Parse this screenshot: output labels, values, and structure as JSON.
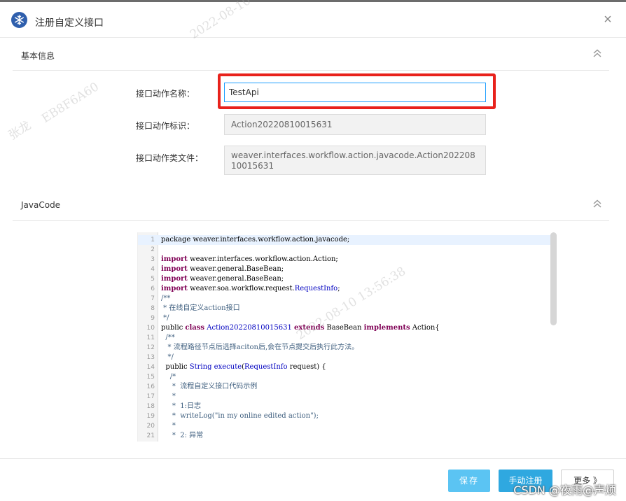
{
  "dialog": {
    "title": "注册自定义接口",
    "close_label": "×"
  },
  "sections": {
    "basic_info": {
      "title": "基本信息"
    },
    "java_code": {
      "title": "JavaCode"
    }
  },
  "form": {
    "action_name_label": "接口动作名称：",
    "action_name_value": "TestApi",
    "action_id_label": "接口动作标识：",
    "action_id_value": "Action20220810015631",
    "action_class_label": "接口动作类文件：",
    "action_class_value": "weaver.interfaces.workflow.action.javacode.Action20220810015631"
  },
  "code": {
    "lines": [
      {
        "n": "1",
        "t": "package weaver.interfaces.workflow.action.javacode;"
      },
      {
        "n": "2",
        "t": ""
      },
      {
        "n": "3",
        "t": "import weaver.interfaces.workflow.action.Action;"
      },
      {
        "n": "4",
        "t": "import weaver.general.BaseBean;"
      },
      {
        "n": "5",
        "t": "import weaver.general.BaseBean;"
      },
      {
        "n": "6",
        "t": "import weaver.soa.workflow.request.RequestInfo;"
      },
      {
        "n": "7",
        "t": "/**"
      },
      {
        "n": "8",
        "t": " * 在线自定义action接口"
      },
      {
        "n": "9",
        "t": " */"
      },
      {
        "n": "10",
        "t": "public class Action20220810015631 extends BaseBean implements Action{"
      },
      {
        "n": "11",
        "t": "  /**"
      },
      {
        "n": "12",
        "t": "   * 流程路径节点后选择aciton后,会在节点提交后执行此方法。"
      },
      {
        "n": "13",
        "t": "   */"
      },
      {
        "n": "14",
        "t": "  public String execute(RequestInfo request) {"
      },
      {
        "n": "15",
        "t": "    /*"
      },
      {
        "n": "16",
        "t": "     *  流程自定义接口代码示例"
      },
      {
        "n": "17",
        "t": "     *"
      },
      {
        "n": "18",
        "t": "     *  1:日志"
      },
      {
        "n": "19",
        "t": "     *  writeLog(\"in my online edited action\");"
      },
      {
        "n": "20",
        "t": "     *"
      },
      {
        "n": "21",
        "t": "     *  2: 异常"
      }
    ]
  },
  "footer": {
    "save_label": "保存",
    "register_label": "手动注册",
    "more_label": "更多 》"
  },
  "watermarks": {
    "name": "张龙",
    "code": "EB8F6A60",
    "datetime": "2022-08-10  13:56:38"
  },
  "overlay": {
    "csdn": "CSDN @夜雨@声烦"
  },
  "colors": {
    "accent": "#1e9fff",
    "save_button": "#5bc4f3",
    "register_button": "#2fa8e0",
    "highlight": "#e8221c"
  },
  "icons": {
    "title": "snowflake-icon",
    "close": "close-icon",
    "collapse": "double-chevron-up-icon"
  }
}
